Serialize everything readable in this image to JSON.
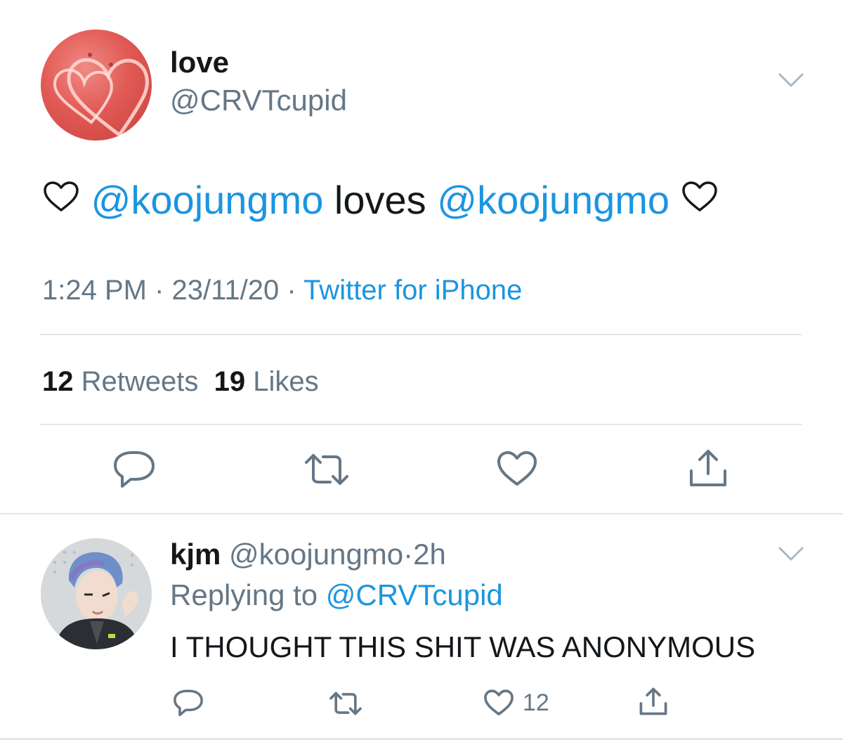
{
  "tweet": {
    "author_name": "love",
    "author_handle": "@CRVTcupid",
    "text_parts": {
      "mention_1": "@koojungmo",
      "middle": " loves ",
      "mention_2": "@koojungmo"
    },
    "time": "1:24 PM",
    "sep1": " · ",
    "date": "23/11/20",
    "sep2": " · ",
    "source": "Twitter for iPhone",
    "retweets_count": "12",
    "retweets_label": "Retweets",
    "likes_count": "19",
    "likes_label": "Likes"
  },
  "reply": {
    "author_name": "kjm",
    "author_handle": "@koojungmo",
    "sep": "·",
    "age": "2h",
    "replying_prefix": "Replying to ",
    "replying_to": "@CRVTcupid",
    "text": "I THOUGHT THIS SHIT WAS ANONYMOUS",
    "like_count": "12"
  },
  "colors": {
    "accent": "#1b95e0",
    "muted": "#657786",
    "text": "#14171a",
    "divider": "#e1e8ed"
  },
  "icons": [
    "chevron-down-icon",
    "heart-icon",
    "reply-icon",
    "retweet-icon",
    "like-icon",
    "share-icon"
  ]
}
